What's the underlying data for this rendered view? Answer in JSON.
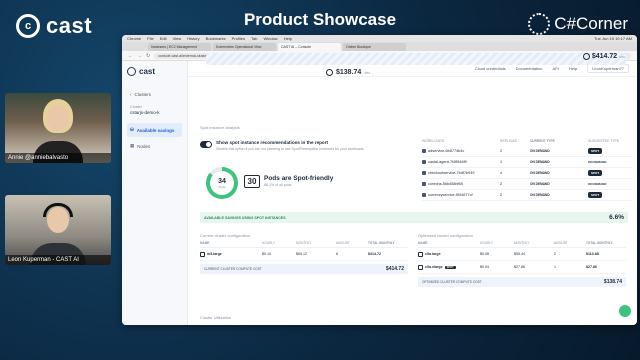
{
  "brand_left": "cast",
  "event_title": "Product Showcase",
  "brand_right": "C#Corner",
  "presenters": [
    {
      "name": "Annie @anniebalvasto"
    },
    {
      "name": "Leon Kuperman - CAST AI"
    }
  ],
  "browser": {
    "menu": [
      "Chrome",
      "File",
      "Edit",
      "View",
      "History",
      "Bookmarks",
      "Profiles",
      "Tab",
      "Window",
      "Help"
    ],
    "clock": "Tue Jun 15 10:17 AM",
    "tabs": [
      "Instances | EC2 Management",
      "Kubernetes Operational View",
      "CAST AI – Console",
      "Online Boutique"
    ],
    "url": "console.cast.ai/external-clusters/8c9d-77ba-48aa-4ba6-8d84-af77548b014c/savings"
  },
  "sidebar": {
    "logo": "cast",
    "items": [
      {
        "label": "Clusters"
      },
      {
        "label": "Available savings"
      },
      {
        "label": "Nodes"
      }
    ],
    "cluster_caption": "Cluster",
    "cluster_name": "cstarjs-demo-k"
  },
  "topbar": {
    "links": [
      "Cloud credentials",
      "Documentation",
      "API",
      "Help"
    ],
    "user": "LeonKuperman77"
  },
  "summary": {
    "total": "$414.72",
    "total_unit": "/mo",
    "optimized": "$138.74",
    "optimized_unit": "/mo"
  },
  "spot_panel": {
    "section_title": "Spot instance analysis",
    "toggle_label": "Show spot instance recommendations in the report",
    "toggle_sub": "Disable this option if you are not planning to use Spot/Preemptible instances for your workloads",
    "donut_number": "34",
    "donut_unit": "Pods",
    "spot_count": "30",
    "spot_text": "Pods are Spot-friendly",
    "spot_sub": "88.2% of all pods"
  },
  "workloads": {
    "headers": [
      "WORKLOADS",
      "REPLICAS",
      "CURRENT TYPE",
      "SUGGESTED TYPE"
    ],
    "rows": [
      {
        "name": "adservice-6b8774b4c",
        "replicas": "2",
        "current": "ON DEMAND",
        "suggested": "SPOT",
        "spot": true
      },
      {
        "name": "castai-agent-7f4ff546f9",
        "replicas": "1",
        "current": "ON DEMAND",
        "suggested": "ON DEMAND",
        "spot": false
      },
      {
        "name": "checkoutservice-7bdf7b949",
        "replicas": "4",
        "current": "ON DEMAND",
        "suggested": "SPOT",
        "spot": true
      },
      {
        "name": "coredns-56b458bf65",
        "replicas": "2",
        "current": "ON DEMAND",
        "suggested": "ON DEMAND",
        "spot": false
      },
      {
        "name": "currencyservice-5f44677cf",
        "replicas": "2",
        "current": "ON DEMAND",
        "suggested": "SPOT",
        "spot": true
      }
    ]
  },
  "savings": {
    "label": "AVAILABLE SAVINGS USING SPOT INSTANCES",
    "pct": "6.6%"
  },
  "current_config": {
    "title": "Current cluster configuration",
    "headers": [
      "NAME",
      "HOURLY",
      "MONTHLY",
      "AMOUNT",
      "TOTAL MONTHLY"
    ],
    "rows": [
      {
        "name": "m5.large",
        "spot": false,
        "hourly": "$0.10",
        "monthly": "$69.12",
        "amount": "6",
        "total": "$414.72"
      }
    ],
    "total_label": "CURRENT CLUSTER COMPUTE COST",
    "total": "$414.72"
  },
  "optimized_config": {
    "title": "Optimized cluster configuration",
    "headers": [
      "NAME",
      "HOURLY",
      "MONTHLY",
      "AMOUNT",
      "TOTAL MONTHLY"
    ],
    "rows": [
      {
        "name": "c5a.large",
        "spot": false,
        "hourly": "$0.08",
        "monthly": "$55.44",
        "amount": "2",
        "total": "$110.88"
      },
      {
        "name": "c5a.xlarge",
        "spot": true,
        "spot_label": "SPOT",
        "hourly": "$0.04",
        "monthly": "$27.86",
        "amount": "1",
        "total": "$27.86"
      }
    ],
    "total_label": "OPTIMIZED CLUSTER COMPUTE COST",
    "total": "$138.74"
  },
  "footer_section": "Cluster Utilization",
  "colors": {
    "accent": "#3cc47c",
    "primary": "#1f2a37",
    "link": "#1d5fd0",
    "backdrop": "#0d2b44"
  }
}
